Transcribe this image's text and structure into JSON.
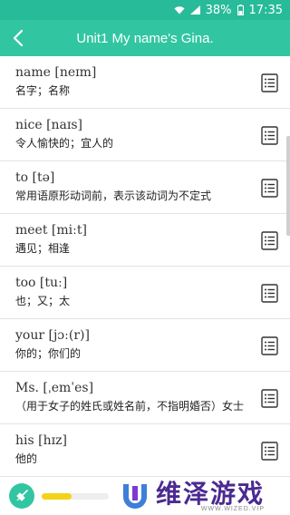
{
  "status": {
    "battery": "38%",
    "time": "17:35",
    "icons": [
      "wifi-icon",
      "signal-icon",
      "battery-icon"
    ]
  },
  "header": {
    "title": "Unit1 My name's Gina.",
    "back_icon": "chevron-left-icon"
  },
  "words": [
    {
      "head": "name [neɪm]",
      "def": "名字；名称"
    },
    {
      "head": "nice [naɪs]",
      "def": "令人愉快的；宜人的"
    },
    {
      "head": "to [tə]",
      "def": "常用语原形动词前，表示该动词为不定式"
    },
    {
      "head": "meet [miːt]",
      "def": "遇见；相逢"
    },
    {
      "head": "too [tuː]",
      "def": "也；又；太"
    },
    {
      "head": "your [jɔː(r)]",
      "def": "你的；你们的"
    },
    {
      "head": "Ms. [ˌemˈes]",
      "def": "（用于女子的姓氏或姓名前，不指明婚否）女士"
    },
    {
      "head": "his [hɪz]",
      "def": "他的"
    },
    {
      "head": "",
      "def": ""
    }
  ],
  "player": {
    "progress_percent": 45
  },
  "brand": {
    "name": "维泽游戏",
    "url": "WWW.WIZED.VIP"
  },
  "colors": {
    "primary": "#31c6a1",
    "status": "#28bb9a",
    "accent_yellow": "#f4d21a",
    "brand_purple": "#4b2a91"
  }
}
